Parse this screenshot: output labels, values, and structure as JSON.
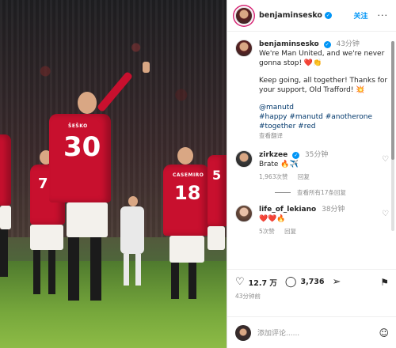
{
  "photo": {
    "players": [
      {
        "number": "30",
        "shirt_name": "ŠEŠKO"
      },
      {
        "number": "18",
        "shirt_name": "CASEMIRO"
      },
      {
        "number": "5",
        "shirt_name": ""
      },
      {
        "number": "7",
        "shirt_name": ""
      }
    ]
  },
  "header": {
    "username": "benjaminsesko",
    "follow_label": "关注",
    "more_icon": "more-dots-icon"
  },
  "caption": {
    "username": "benjaminsesko",
    "time": "43分钟",
    "line1": "We're Man United, and we're never gonna stop! ❤️👏",
    "line2": "Keep going, all together! Thanks for your support, Old Trafford! 💥",
    "mention": "@manutd",
    "hashtags": "#happy #manutd #anotherone",
    "hashtags2": "#together #red",
    "translate": "查看翻译"
  },
  "comments": [
    {
      "username": "zirkzee",
      "time": "35分钟",
      "text": "Brate 🔥✈️",
      "likes": "1,963次赞",
      "reply": "回复",
      "view_replies": "查看所有17条回复"
    },
    {
      "username": "life_of_lekiano",
      "time": "38分钟",
      "text": "❤️❤️🔥",
      "likes": "5次赞",
      "reply": "回复"
    }
  ],
  "actions": {
    "likes": "12.7 万",
    "comments": "3,736",
    "posted": "43分钟前"
  },
  "composer": {
    "placeholder": "添加评论......"
  },
  "colors": {
    "accent": "#0095f6",
    "united_red": "#c8102e",
    "text": "#262626",
    "muted": "#8e8e8e"
  }
}
